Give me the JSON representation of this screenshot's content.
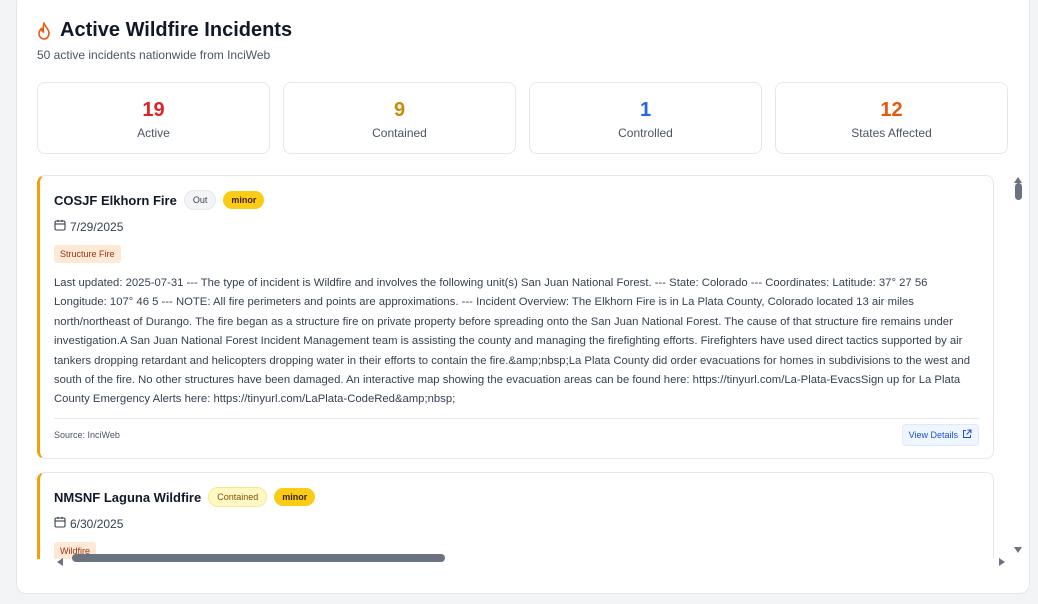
{
  "header": {
    "icon": "flame-icon",
    "title": "Active Wildfire Incidents",
    "subtitle": "50 active incidents nationwide from InciWeb"
  },
  "stats": [
    {
      "value": "19",
      "label": "Active",
      "color": "#dc2626"
    },
    {
      "value": "9",
      "label": "Contained",
      "color": "#ca8a04"
    },
    {
      "value": "1",
      "label": "Controlled",
      "color": "#2563eb"
    },
    {
      "value": "12",
      "label": "States Affected",
      "color": "#ea580c"
    }
  ],
  "incidents": [
    {
      "name": "COSJF Elkhorn Fire",
      "status": "Out",
      "severity": "minor",
      "date": "7/29/2025",
      "type": "Structure Fire",
      "description": "Last updated: 2025-07-31 --- The type of incident is Wildfire and involves the following unit(s) San Juan National Forest. --- State: Colorado --- Coordinates: Latitude: 37° 27 56 Longitude: 107° 46 5 --- NOTE: All fire perimeters and points are approximations. --- Incident Overview: The Elkhorn Fire is in La Plata County, Colorado located 13 air miles north/northeast of Durango. The fire began as a structure fire on private property before spreading onto the San Juan National Forest. The cause of that structure fire remains under investigation.A San Juan National Forest Incident Management team is assisting the county and managing the firefighting efforts. Firefighters have used direct tactics supported by air tankers dropping retardant and helicopters dropping water in their efforts to contain the fire.&amp;nbsp;La Plata County did order evacuations for homes in subdivisions to the west and south of the fire. No other structures have been damaged. An interactive map showing the evacuation areas can be found here: https://tinyurl.com/La-Plata-EvacsSign up for La Plata County Emergency Alerts here: https://tinyurl.com/LaPlata-CodeRed&amp;nbsp;",
      "source": "Source: InciWeb",
      "action": "View Details"
    },
    {
      "name": "NMSNF Laguna Wildfire",
      "status": "Contained",
      "severity": "minor",
      "date": "6/30/2025",
      "type": "Wildfire"
    }
  ]
}
